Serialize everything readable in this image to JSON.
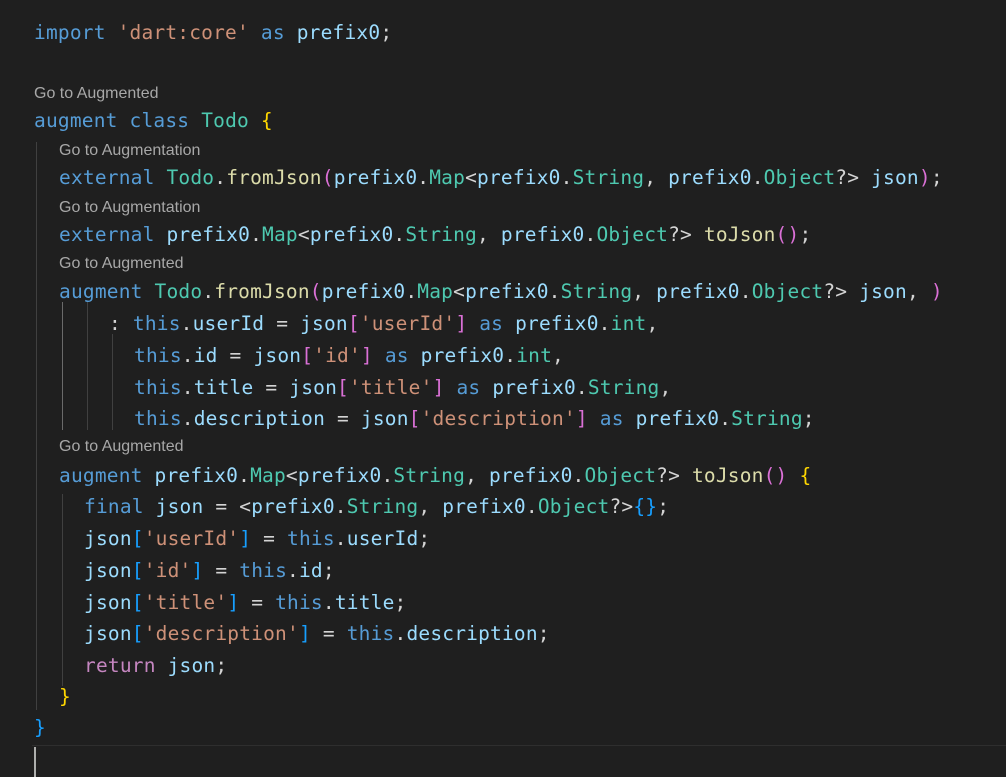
{
  "code_lens": [
    "Go to Augmented",
    "Go to Augmentation",
    "Go to Augmentation",
    "Go to Augmented",
    "Go to Augmented"
  ],
  "code_lines": [
    [
      [
        "kw",
        "import"
      ],
      [
        "p",
        " "
      ],
      [
        "str",
        "'dart:core'"
      ],
      [
        "p",
        " "
      ],
      [
        "kw",
        "as"
      ],
      [
        "p",
        " "
      ],
      [
        "var",
        "prefix0"
      ],
      [
        "p",
        ";"
      ]
    ],
    [
      [
        "kw",
        "augment"
      ],
      [
        "p",
        " "
      ],
      [
        "kw",
        "class"
      ],
      [
        "p",
        " "
      ],
      [
        "ty",
        "Todo"
      ],
      [
        "p",
        " "
      ],
      [
        "b1",
        "{"
      ]
    ],
    [
      [
        "kw",
        "external"
      ],
      [
        "p",
        " "
      ],
      [
        "ty",
        "Todo"
      ],
      [
        "p",
        "."
      ],
      [
        "fn",
        "fromJson"
      ],
      [
        "b2",
        "("
      ],
      [
        "var",
        "prefix0"
      ],
      [
        "p",
        "."
      ],
      [
        "ty",
        "Map"
      ],
      [
        "p",
        "<"
      ],
      [
        "var",
        "prefix0"
      ],
      [
        "p",
        "."
      ],
      [
        "ty",
        "String"
      ],
      [
        "p",
        ", "
      ],
      [
        "var",
        "prefix0"
      ],
      [
        "p",
        "."
      ],
      [
        "ty",
        "Object"
      ],
      [
        "p",
        "?> "
      ],
      [
        "var",
        "json"
      ],
      [
        "b2",
        ")"
      ],
      [
        "p",
        ";"
      ]
    ],
    [
      [
        "kw",
        "external"
      ],
      [
        "p",
        " "
      ],
      [
        "var",
        "prefix0"
      ],
      [
        "p",
        "."
      ],
      [
        "ty",
        "Map"
      ],
      [
        "p",
        "<"
      ],
      [
        "var",
        "prefix0"
      ],
      [
        "p",
        "."
      ],
      [
        "ty",
        "String"
      ],
      [
        "p",
        ", "
      ],
      [
        "var",
        "prefix0"
      ],
      [
        "p",
        "."
      ],
      [
        "ty",
        "Object"
      ],
      [
        "p",
        "?> "
      ],
      [
        "fn",
        "toJson"
      ],
      [
        "b2",
        "()"
      ],
      [
        "p",
        ";"
      ]
    ],
    [
      [
        "kw",
        "augment"
      ],
      [
        "p",
        " "
      ],
      [
        "ty",
        "Todo"
      ],
      [
        "p",
        "."
      ],
      [
        "fn",
        "fromJson"
      ],
      [
        "b2",
        "("
      ],
      [
        "var",
        "prefix0"
      ],
      [
        "p",
        "."
      ],
      [
        "ty",
        "Map"
      ],
      [
        "p",
        "<"
      ],
      [
        "var",
        "prefix0"
      ],
      [
        "p",
        "."
      ],
      [
        "ty",
        "String"
      ],
      [
        "p",
        ", "
      ],
      [
        "var",
        "prefix0"
      ],
      [
        "p",
        "."
      ],
      [
        "ty",
        "Object"
      ],
      [
        "p",
        "?> "
      ],
      [
        "var",
        "json"
      ],
      [
        "p",
        ", "
      ],
      [
        "b2",
        ")"
      ]
    ],
    [
      [
        "p",
        ": "
      ],
      [
        "kw",
        "this"
      ],
      [
        "p",
        "."
      ],
      [
        "var",
        "userId"
      ],
      [
        "p",
        " = "
      ],
      [
        "var",
        "json"
      ],
      [
        "b2",
        "["
      ],
      [
        "str",
        "'userId'"
      ],
      [
        "b2",
        "]"
      ],
      [
        "p",
        " "
      ],
      [
        "kw",
        "as"
      ],
      [
        "p",
        " "
      ],
      [
        "var",
        "prefix0"
      ],
      [
        "p",
        "."
      ],
      [
        "ty",
        "int"
      ],
      [
        "p",
        ","
      ]
    ],
    [
      [
        "kw",
        "this"
      ],
      [
        "p",
        "."
      ],
      [
        "var",
        "id"
      ],
      [
        "p",
        " = "
      ],
      [
        "var",
        "json"
      ],
      [
        "b2",
        "["
      ],
      [
        "str",
        "'id'"
      ],
      [
        "b2",
        "]"
      ],
      [
        "p",
        " "
      ],
      [
        "kw",
        "as"
      ],
      [
        "p",
        " "
      ],
      [
        "var",
        "prefix0"
      ],
      [
        "p",
        "."
      ],
      [
        "ty",
        "int"
      ],
      [
        "p",
        ","
      ]
    ],
    [
      [
        "kw",
        "this"
      ],
      [
        "p",
        "."
      ],
      [
        "var",
        "title"
      ],
      [
        "p",
        " = "
      ],
      [
        "var",
        "json"
      ],
      [
        "b2",
        "["
      ],
      [
        "str",
        "'title'"
      ],
      [
        "b2",
        "]"
      ],
      [
        "p",
        " "
      ],
      [
        "kw",
        "as"
      ],
      [
        "p",
        " "
      ],
      [
        "var",
        "prefix0"
      ],
      [
        "p",
        "."
      ],
      [
        "ty",
        "String"
      ],
      [
        "p",
        ","
      ]
    ],
    [
      [
        "kw",
        "this"
      ],
      [
        "p",
        "."
      ],
      [
        "var",
        "description"
      ],
      [
        "p",
        " = "
      ],
      [
        "var",
        "json"
      ],
      [
        "b2",
        "["
      ],
      [
        "str",
        "'description'"
      ],
      [
        "b2",
        "]"
      ],
      [
        "p",
        " "
      ],
      [
        "kw",
        "as"
      ],
      [
        "p",
        " "
      ],
      [
        "var",
        "prefix0"
      ],
      [
        "p",
        "."
      ],
      [
        "ty",
        "String"
      ],
      [
        "p",
        ";"
      ]
    ],
    [
      [
        "kw",
        "augment"
      ],
      [
        "p",
        " "
      ],
      [
        "var",
        "prefix0"
      ],
      [
        "p",
        "."
      ],
      [
        "ty",
        "Map"
      ],
      [
        "p",
        "<"
      ],
      [
        "var",
        "prefix0"
      ],
      [
        "p",
        "."
      ],
      [
        "ty",
        "String"
      ],
      [
        "p",
        ", "
      ],
      [
        "var",
        "prefix0"
      ],
      [
        "p",
        "."
      ],
      [
        "ty",
        "Object"
      ],
      [
        "p",
        "?> "
      ],
      [
        "fn",
        "toJson"
      ],
      [
        "b2",
        "()"
      ],
      [
        "p",
        " "
      ],
      [
        "b1",
        "{"
      ]
    ],
    [
      [
        "kw",
        "final"
      ],
      [
        "p",
        " "
      ],
      [
        "var",
        "json"
      ],
      [
        "p",
        " = <"
      ],
      [
        "var",
        "prefix0"
      ],
      [
        "p",
        "."
      ],
      [
        "ty",
        "String"
      ],
      [
        "p",
        ", "
      ],
      [
        "var",
        "prefix0"
      ],
      [
        "p",
        "."
      ],
      [
        "ty",
        "Object"
      ],
      [
        "p",
        "?>"
      ],
      [
        "b3",
        "{}"
      ],
      [
        "p",
        ";"
      ]
    ],
    [
      [
        "var",
        "json"
      ],
      [
        "b3",
        "["
      ],
      [
        "str",
        "'userId'"
      ],
      [
        "b3",
        "]"
      ],
      [
        "p",
        " = "
      ],
      [
        "kw",
        "this"
      ],
      [
        "p",
        "."
      ],
      [
        "var",
        "userId"
      ],
      [
        "p",
        ";"
      ]
    ],
    [
      [
        "var",
        "json"
      ],
      [
        "b3",
        "["
      ],
      [
        "str",
        "'id'"
      ],
      [
        "b3",
        "]"
      ],
      [
        "p",
        " = "
      ],
      [
        "kw",
        "this"
      ],
      [
        "p",
        "."
      ],
      [
        "var",
        "id"
      ],
      [
        "p",
        ";"
      ]
    ],
    [
      [
        "var",
        "json"
      ],
      [
        "b3",
        "["
      ],
      [
        "str",
        "'title'"
      ],
      [
        "b3",
        "]"
      ],
      [
        "p",
        " = "
      ],
      [
        "kw",
        "this"
      ],
      [
        "p",
        "."
      ],
      [
        "var",
        "title"
      ],
      [
        "p",
        ";"
      ]
    ],
    [
      [
        "var",
        "json"
      ],
      [
        "b3",
        "["
      ],
      [
        "str",
        "'description'"
      ],
      [
        "b3",
        "]"
      ],
      [
        "p",
        " = "
      ],
      [
        "kw",
        "this"
      ],
      [
        "p",
        "."
      ],
      [
        "var",
        "description"
      ],
      [
        "p",
        ";"
      ]
    ],
    [
      [
        "ctl",
        "return"
      ],
      [
        "p",
        " "
      ],
      [
        "var",
        "json"
      ],
      [
        "p",
        ";"
      ]
    ],
    [
      [
        "b1",
        "}"
      ]
    ],
    [
      [
        "b3",
        "}"
      ]
    ]
  ]
}
